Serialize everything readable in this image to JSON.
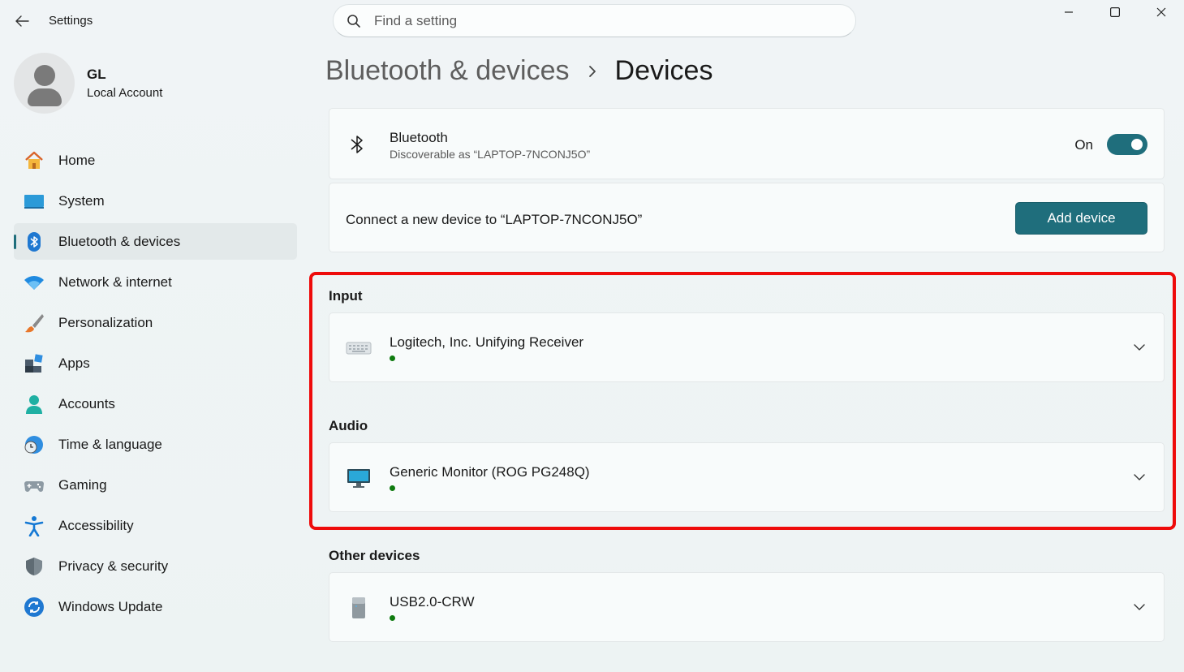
{
  "window": {
    "app_title": "Settings",
    "search_placeholder": "Find a setting"
  },
  "profile": {
    "name": "GL",
    "account_type": "Local Account"
  },
  "sidebar": {
    "items": [
      {
        "label": "Home",
        "icon": "home-icon"
      },
      {
        "label": "System",
        "icon": "system-icon"
      },
      {
        "label": "Bluetooth & devices",
        "icon": "bluetooth-icon",
        "active": true
      },
      {
        "label": "Network & internet",
        "icon": "wifi-icon"
      },
      {
        "label": "Personalization",
        "icon": "brush-icon"
      },
      {
        "label": "Apps",
        "icon": "apps-icon"
      },
      {
        "label": "Accounts",
        "icon": "accounts-icon"
      },
      {
        "label": "Time & language",
        "icon": "time-language-icon"
      },
      {
        "label": "Gaming",
        "icon": "gamepad-icon"
      },
      {
        "label": "Accessibility",
        "icon": "accessibility-icon"
      },
      {
        "label": "Privacy & security",
        "icon": "shield-icon"
      },
      {
        "label": "Windows Update",
        "icon": "update-icon"
      }
    ]
  },
  "breadcrumb": {
    "parent": "Bluetooth & devices",
    "current": "Devices"
  },
  "bluetooth": {
    "title": "Bluetooth",
    "subtitle": "Discoverable as “LAPTOP-7NCONJ5O”",
    "state_label": "On",
    "enabled": true
  },
  "connect": {
    "text": "Connect a new device to “LAPTOP-7NCONJ5O”",
    "button_label": "Add device"
  },
  "sections": {
    "input": {
      "title": "Input",
      "device": {
        "name": "Logitech, Inc. Unifying Receiver",
        "icon": "keyboard-icon",
        "status": "connected"
      }
    },
    "audio": {
      "title": "Audio",
      "device": {
        "name": "Generic Monitor (ROG PG248Q)",
        "icon": "monitor-icon",
        "status": "connected"
      }
    },
    "other": {
      "title": "Other devices",
      "device": {
        "name": "USB2.0-CRW",
        "icon": "usb-drive-icon",
        "status": "connected"
      }
    }
  },
  "colors": {
    "accent": "#1f6e7c",
    "highlight": "#ee0b0b",
    "status_connected": "#0f7b0f"
  }
}
